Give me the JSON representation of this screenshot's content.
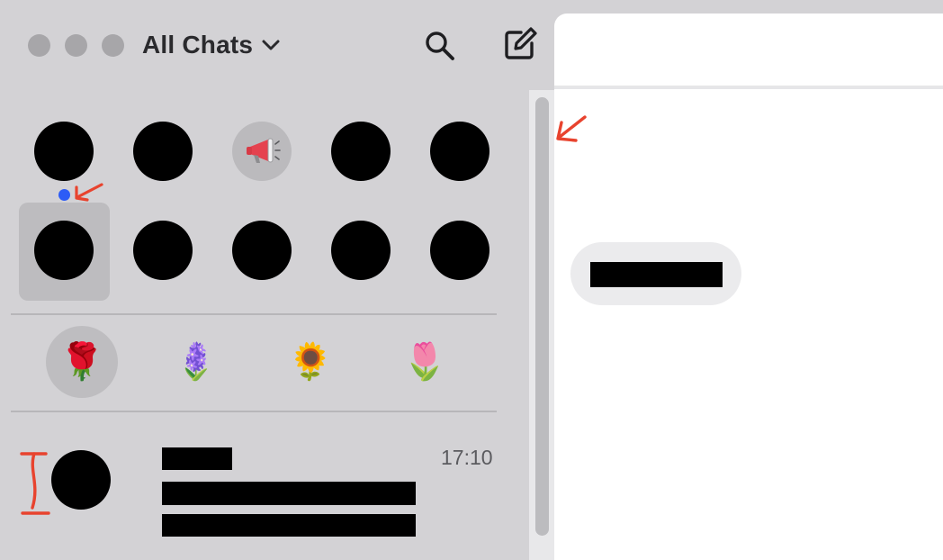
{
  "window": {
    "title": "All Chats",
    "traffic_lights": [
      "close",
      "minimize",
      "zoom"
    ]
  },
  "toolbar": {
    "search_icon": "magnifier",
    "compose_icon": "square-pencil",
    "title_chevron_icon": "chevron-down"
  },
  "pinned": {
    "unread_indicator_color": "#2d5cf6",
    "items": [
      {
        "type": "avatar",
        "selected": false,
        "unread": true
      },
      {
        "type": "avatar",
        "selected": false,
        "unread": false
      },
      {
        "type": "megaphone",
        "selected": false,
        "unread": false
      },
      {
        "type": "avatar",
        "selected": false,
        "unread": false
      },
      {
        "type": "avatar",
        "selected": false,
        "unread": false
      },
      {
        "type": "avatar",
        "selected": true,
        "unread": false
      },
      {
        "type": "avatar",
        "selected": false,
        "unread": false
      },
      {
        "type": "avatar",
        "selected": false,
        "unread": false
      },
      {
        "type": "avatar",
        "selected": false,
        "unread": false
      },
      {
        "type": "avatar",
        "selected": false,
        "unread": false
      }
    ]
  },
  "filters": {
    "items": [
      {
        "glyph": "🌹",
        "name": "rose",
        "active": true
      },
      {
        "glyph": "🪻",
        "name": "hyacinth",
        "active": false
      },
      {
        "glyph": "🌻",
        "name": "sunflower",
        "active": false
      },
      {
        "glyph": "🌷",
        "name": "tulip",
        "active": false
      }
    ]
  },
  "chat_list": [
    {
      "time": "17:10",
      "name_redacted": true,
      "preview_redacted": true
    }
  ],
  "conversation": {
    "message_redacted": true
  },
  "colors": {
    "sidebar_bg": "#d3d2d5",
    "accent_blue": "#2d5cf6",
    "annotation_red": "#e8432e"
  }
}
